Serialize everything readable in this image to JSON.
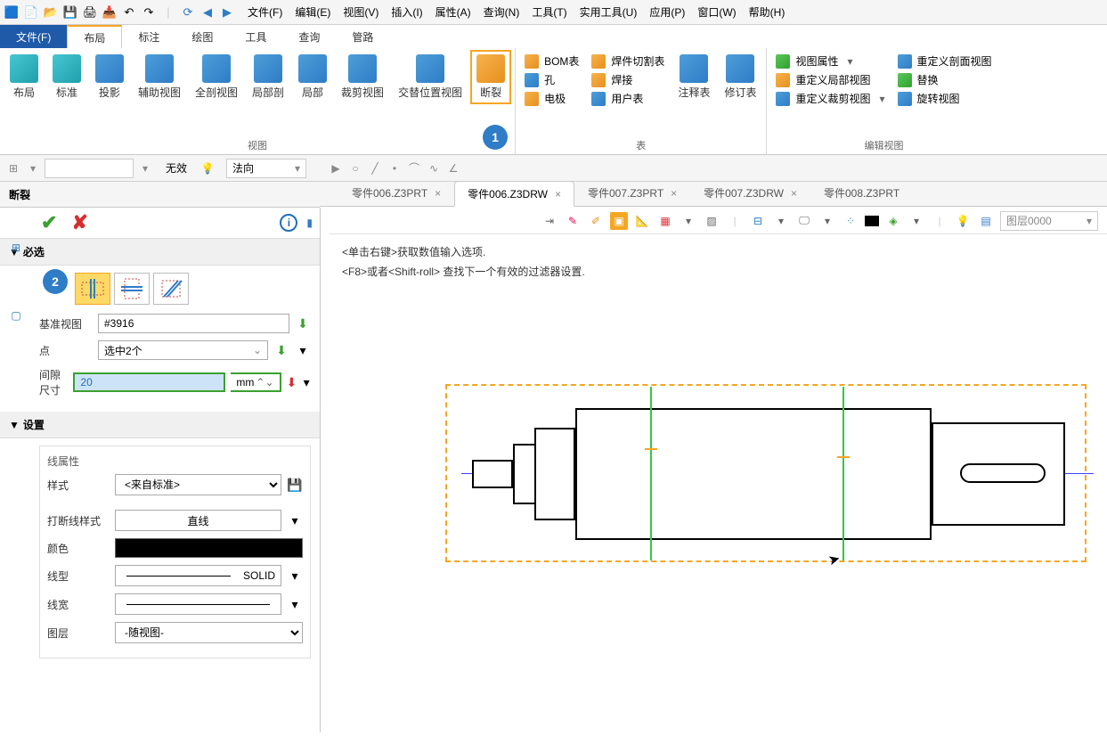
{
  "menubar": {
    "items": [
      "文件(F)",
      "编辑(E)",
      "视图(V)",
      "插入(I)",
      "属性(A)",
      "查询(N)",
      "工具(T)",
      "实用工具(U)",
      "应用(P)",
      "窗口(W)",
      "帮助(H)"
    ]
  },
  "ribbon_tabs": {
    "file": "文件(F)",
    "active": "布局",
    "others": [
      "标注",
      "绘图",
      "工具",
      "查询",
      "管路"
    ]
  },
  "ribbon": {
    "view_group": "视图",
    "layout": "布局",
    "standard": "标准",
    "projection": "投影",
    "aux": "辅助视图",
    "fullsection": "全剖视图",
    "partialsection": "局部剖",
    "partial": "局部",
    "crop": "裁剪视图",
    "alternate": "交替位置视图",
    "break": "断裂",
    "table_group": "表",
    "bom": "BOM表",
    "hole": "孔",
    "electrode": "电极",
    "weldcut": "焊件切割表",
    "weld": "焊接",
    "usertable": "用户表",
    "annotable": "注释表",
    "revtable": "修订表",
    "editview_group": "编辑视图",
    "viewattr": "视图属性",
    "redef_partial": "重定义局部视图",
    "redef_crop": "重定义裁剪视图",
    "redef_section": "重定义剖面视图",
    "replace": "替换",
    "rotate": "旋转视图"
  },
  "subtoolbar": {
    "invalid": "无效",
    "normal": "法向"
  },
  "panel": {
    "title": "断裂",
    "required": "必选",
    "base_view": "基准视图",
    "base_view_val": "#3916",
    "point": "点",
    "point_val": "选中2个",
    "gap": "间隙尺寸",
    "gap_val": "20",
    "gap_unit": "mm",
    "settings": "设置",
    "line_attrs": "线属性",
    "style": "样式",
    "style_val": "<来自标准>",
    "breakstyle": "打断线样式",
    "breakstyle_val": "直线",
    "color": "颜色",
    "linetype": "线型",
    "linetype_val": "SOLID",
    "linewidth": "线宽",
    "layer": "图层",
    "layer_val": "-随视图-"
  },
  "tabs": {
    "t1": "零件006.Z3PRT",
    "t2": "零件006.Z3DRW",
    "t3": "零件007.Z3PRT",
    "t4": "零件007.Z3DRW",
    "t5": "零件008.Z3PRT"
  },
  "canvas": {
    "hint1": "<单击右键>获取数值输入选项.",
    "hint2": "<F8>或者<Shift-roll> 查找下一个有效的过滤器设置.",
    "layer": "图层0000"
  },
  "steps": {
    "s1": "1",
    "s2": "2"
  }
}
